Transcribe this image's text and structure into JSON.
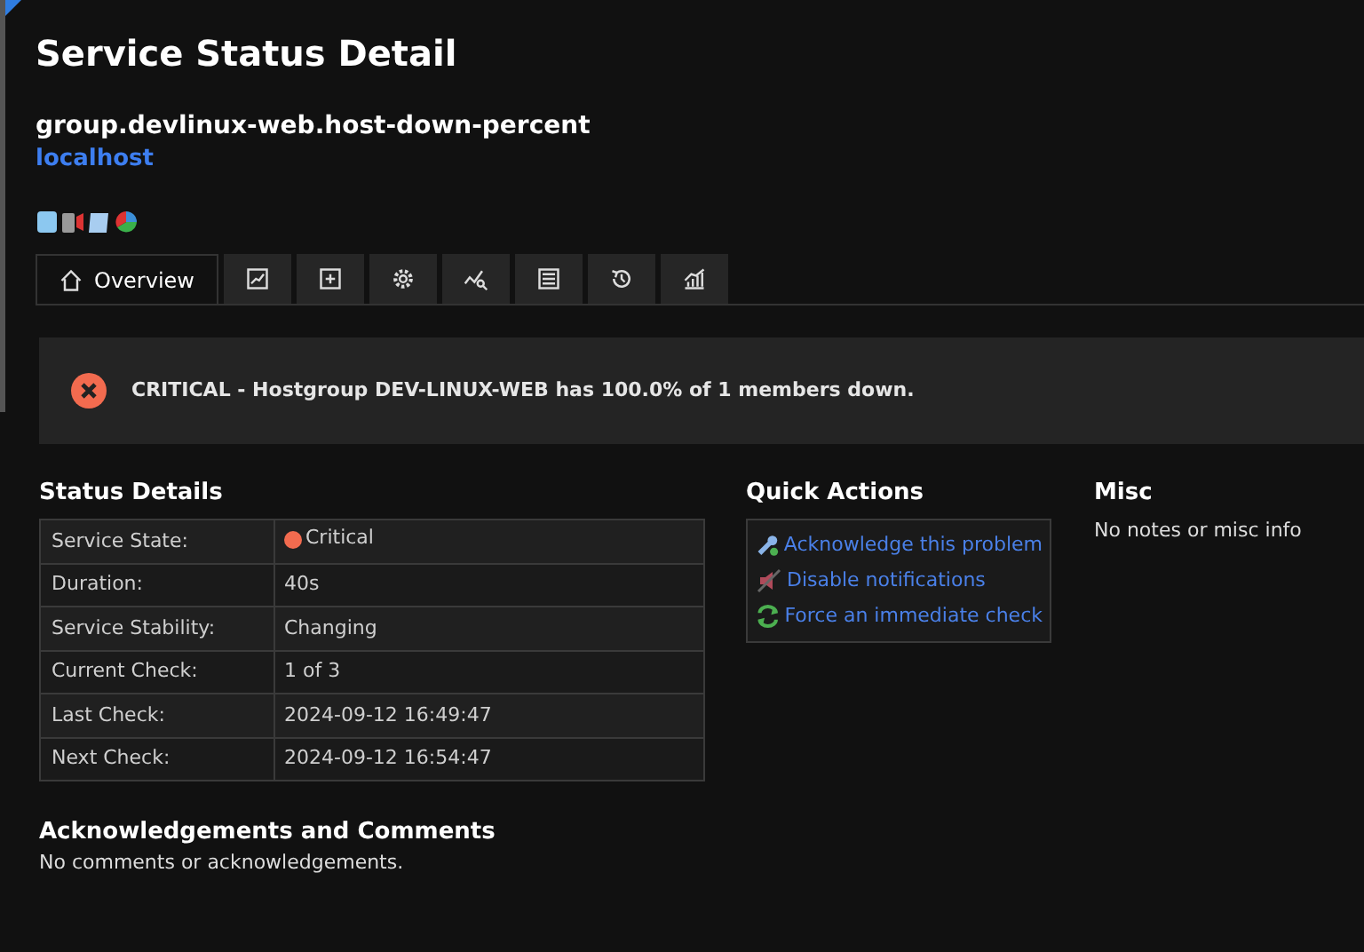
{
  "page": {
    "title": "Service Status Detail"
  },
  "service": {
    "name": "group.devlinux-web.host-down-percent",
    "host": "localhost"
  },
  "tabs": [
    {
      "label": "Overview",
      "selected": true
    },
    {
      "selected": false
    },
    {
      "selected": false
    },
    {
      "selected": false
    },
    {
      "selected": false
    },
    {
      "selected": false
    },
    {
      "selected": false
    },
    {
      "selected": false
    }
  ],
  "alert": {
    "kind": "error",
    "message": "CRITICAL - Hostgroup DEV-LINUX-WEB has 100.0% of 1 members down."
  },
  "status_details": {
    "title": "Status Details",
    "rows": [
      {
        "label": "Service State:",
        "value": "Critical",
        "color": "#f26b4f"
      },
      {
        "label": "Duration:",
        "value": "40s"
      },
      {
        "label": "Service Stability:",
        "value": "Changing"
      },
      {
        "label": "Current Check:",
        "value": "1 of 3"
      },
      {
        "label": "Last Check:",
        "value": "2024-09-12 16:49:47"
      },
      {
        "label": "Next Check:",
        "value": "2024-09-12 16:54:47"
      }
    ]
  },
  "quick_actions": {
    "title": "Quick Actions",
    "items": [
      {
        "label": "Acknowledge this problem"
      },
      {
        "label": "Disable notifications"
      },
      {
        "label": "Force an immediate check"
      }
    ]
  },
  "misc": {
    "title": "Misc",
    "text": "No notes or misc info"
  },
  "comments": {
    "title": "Acknowledgements and Comments",
    "text": "No comments or acknowledgements."
  }
}
